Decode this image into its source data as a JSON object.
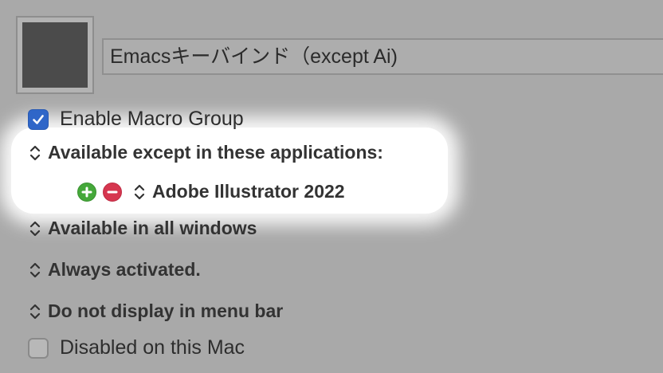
{
  "macro_group": {
    "name": "Emacsキーバインド（except Ai)",
    "icon": "group-icon-swatch",
    "enabled_label": "Enable Macro Group",
    "enabled_checked": true
  },
  "availability": {
    "label": "Available except in these applications:",
    "applications": [
      {
        "name": "Adobe Illustrator 2022"
      }
    ]
  },
  "windows_condition": {
    "label": "Available in all windows"
  },
  "activation": {
    "label": "Always activated."
  },
  "menu_bar": {
    "label": "Do not display in menu bar"
  },
  "disabled_on_mac": {
    "label": "Disabled on this Mac",
    "checked": false
  },
  "colors": {
    "background": "#a9a9a9",
    "checkbox_on": "#2f66c8",
    "add_button": "#45a83a",
    "remove_button": "#d6364f",
    "highlight": "#ffffff"
  }
}
